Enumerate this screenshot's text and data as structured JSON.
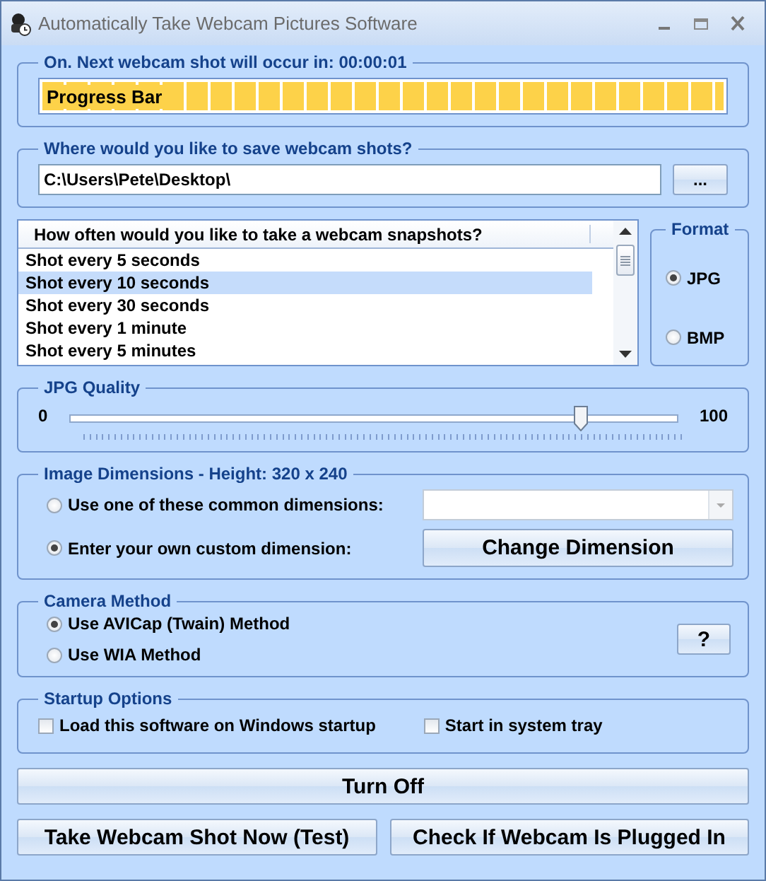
{
  "window": {
    "title": "Automatically Take Webcam Pictures Software"
  },
  "status_group": {
    "title": "On. Next webcam shot will occur in: 00:00:01",
    "progress": {
      "label": "Progress Bar",
      "level": 1
    }
  },
  "save_group": {
    "title": "Where would you like to save webcam shots?",
    "path": {
      "value": "C:\\Users\\Pete\\Desktop\\"
    },
    "browse_button": "..."
  },
  "interval_list": {
    "header": "How often would you like to take a webcam snapshots?",
    "items": [
      {
        "label": "Shot every 5 seconds",
        "selected": false
      },
      {
        "label": "Shot every 10 seconds",
        "selected": true
      },
      {
        "label": "Shot every 30 seconds",
        "selected": false
      },
      {
        "label": "Shot every 1 minute",
        "selected": false
      },
      {
        "label": "Shot every 5 minutes",
        "selected": false
      }
    ]
  },
  "format": {
    "title": "Format",
    "options": [
      {
        "label": "JPG",
        "selected": true
      },
      {
        "label": "BMP",
        "selected": false
      }
    ]
  },
  "quality": {
    "title": "JPG Quality",
    "min": "0",
    "max": "100",
    "level": 0.84
  },
  "dimensions": {
    "title": "Image Dimensions -  Height: 320 x 240",
    "options": [
      {
        "label": "Use one of these common dimensions:",
        "selected": false
      },
      {
        "label": "Enter your own custom dimension:",
        "selected": true
      }
    ],
    "change_button": "Change Dimension"
  },
  "camera": {
    "title": "Camera Method",
    "options": [
      {
        "label": "Use AVICap (Twain) Method",
        "selected": true
      },
      {
        "label": "Use WIA Method",
        "selected": false
      }
    ],
    "help_button": "?"
  },
  "startup": {
    "title": "Startup Options",
    "options": [
      {
        "label": "Load this software on Windows startup",
        "checked": false
      },
      {
        "label": "Start in system tray",
        "checked": false
      }
    ]
  },
  "buttons": {
    "turn_off": "Turn Off",
    "test": "Take Webcam Shot Now (Test)",
    "check": "Check If Webcam Is Plugged In"
  }
}
